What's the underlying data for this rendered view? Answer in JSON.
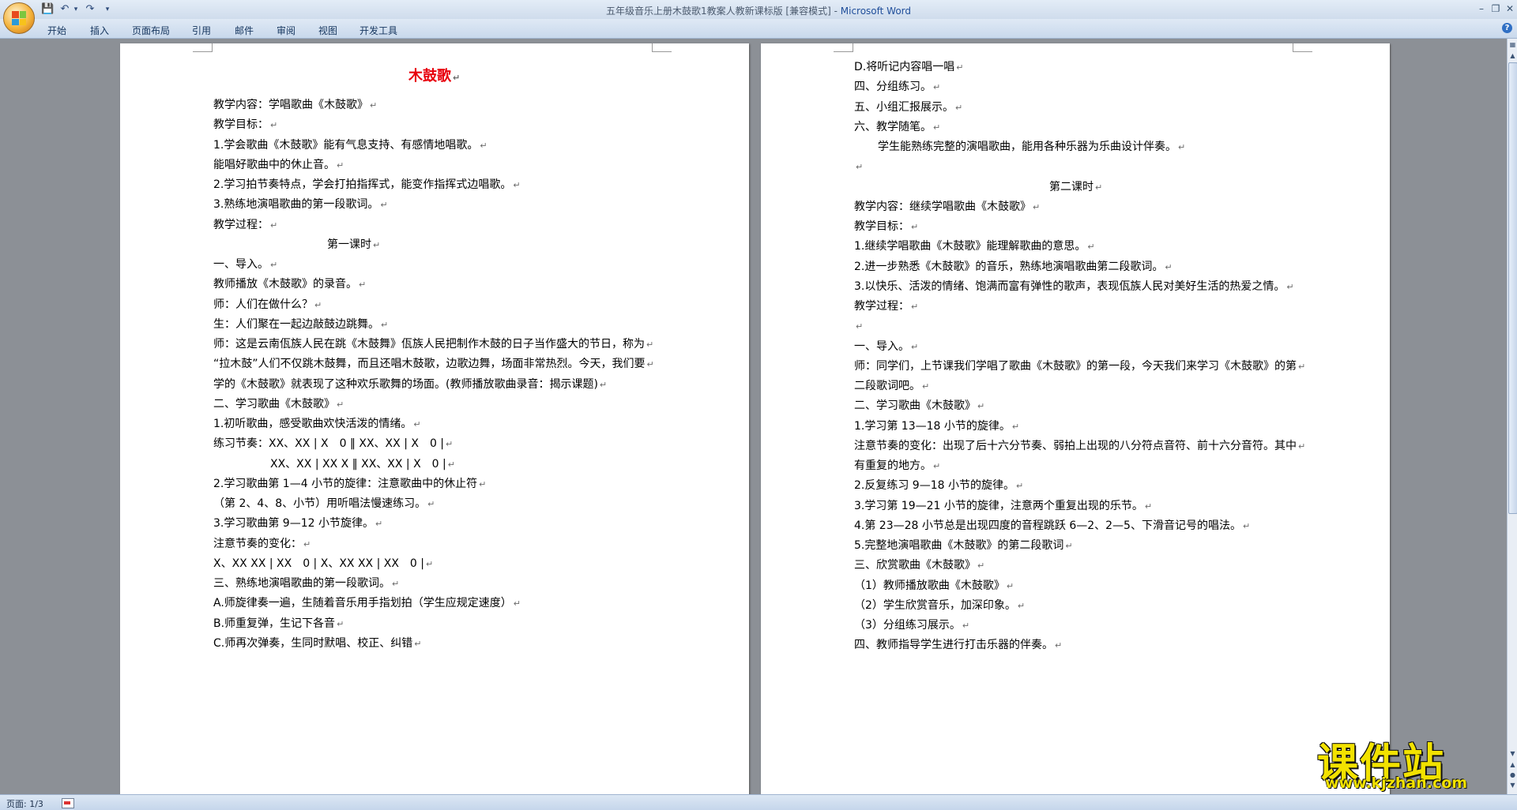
{
  "window": {
    "title": "五年级音乐上册木鼓歌1教案人教新课标版 [兼容模式] - ",
    "app_name": "Microsoft Word"
  },
  "ribbon": {
    "tabs": [
      "开始",
      "插入",
      "页面布局",
      "引用",
      "邮件",
      "审阅",
      "视图",
      "开发工具"
    ]
  },
  "page1": {
    "title": "木鼓歌",
    "lines": [
      "教学内容：学唱歌曲《木鼓歌》",
      "教学目标：",
      "1.学会歌曲《木鼓歌》能有气息支持、有感情地唱歌。",
      "能唱好歌曲中的休止音。",
      "2.学习拍节奏特点，学会打拍指挥式，能变作指挥式边唱歌。",
      "3.熟练地演唱歌曲的第一段歌词。",
      "教学过程：",
      "第一课时",
      "一、导入。",
      "教师播放《木鼓歌》的录音。",
      "师：人们在做什么？",
      "生：人们聚在一起边敲鼓边跳舞。",
      "师：这是云南佤族人民在跳《木鼓舞》佤族人民把制作木鼓的日子当作盛大的节日，称为",
      "“拉木鼓”人们不仅跳木鼓舞，而且还唱木鼓歌，边歌边舞，场面非常热烈。今天，我们要",
      "学的《木鼓歌》就表现了这种欢乐歌舞的场面。(教师播放歌曲录音：揭示课题)",
      "二、学习歌曲《木鼓歌》",
      "1.初听歌曲，感受歌曲欢快活泼的情绪。",
      "练习节奏：XX、XX | X　0 ‖ XX、XX | X　0 |",
      "XX、XX | XX X ‖ XX、XX | X　0 |",
      "2.学习歌曲第 1—4 小节的旋律：注意歌曲中的休止符",
      "（第 2、4、8、小节）用听唱法慢速练习。",
      "3.学习歌曲第 9—12 小节旋律。",
      "注意节奏的变化：",
      "X、XX XX | XX　0 | X、XX XX | XX　0 |",
      "三、熟练地演唱歌曲的第一段歌词。",
      "A.师旋律奏一遍，生随着音乐用手指划拍（学生应规定速度）",
      "B.师重复弹，生记下各音",
      "C.师再次弹奏，生同时默唱、校正、纠错"
    ]
  },
  "page2": {
    "lines": [
      "D.将听记内容唱一唱",
      "四、分组练习。",
      "五、小组汇报展示。",
      "六、教学随笔。",
      "学生能熟练完整的演唱歌曲，能用各种乐器为乐曲设计伴奏。",
      "",
      "第二课时",
      "教学内容：继续学唱歌曲《木鼓歌》",
      "教学目标：",
      "1.继续学唱歌曲《木鼓歌》能理解歌曲的意思。",
      "2.进一步熟悉《木鼓歌》的音乐，熟练地演唱歌曲第二段歌词。",
      "3.以快乐、活泼的情绪、饱满而富有弹性的歌声，表现佤族人民对美好生活的热爱之情。",
      "教学过程：",
      "",
      "一、导入。",
      "师：同学们，上节课我们学唱了歌曲《木鼓歌》的第一段，今天我们来学习《木鼓歌》的第",
      "二段歌词吧。",
      "二、学习歌曲《木鼓歌》",
      "1.学习第 13—18 小节的旋律。",
      "注意节奏的变化：出现了后十六分节奏、弱拍上出现的八分符点音符、前十六分音符。其中",
      "有重复的地方。",
      "2.反复练习 9—18 小节的旋律。",
      "3.学习第 19—21 小节的旋律，注意两个重复出现的乐节。",
      "4.第 23—28 小节总是出现四度的音程跳跃 6—2、2—5、下滑音记号的唱法。",
      "5.完整地演唱歌曲《木鼓歌》的第二段歌词",
      "三、欣赏歌曲《木鼓歌》",
      "（1）教师播放歌曲《木鼓歌》",
      "（2）学生欣赏音乐，加深印象。",
      "（3）分组练习展示。",
      "四、教师指导学生进行打击乐器的伴奏。"
    ]
  },
  "status": {
    "page_label": "页面: 1/3"
  },
  "watermark": {
    "title": "课件站",
    "url": "www.kjzhan.com"
  },
  "colors": {
    "title_red": "#e8000d",
    "watermark_yellow": "#f2e200"
  }
}
